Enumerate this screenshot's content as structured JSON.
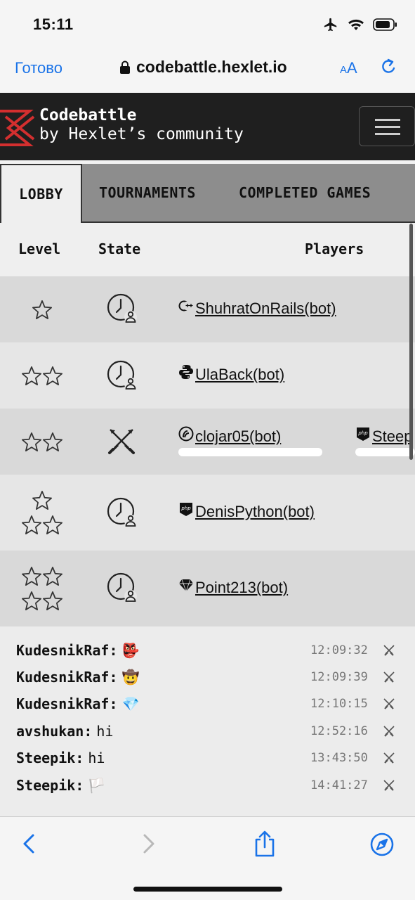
{
  "status_bar": {
    "time": "15:11"
  },
  "browser": {
    "done_label": "Готово",
    "url": "codebattle.hexlet.io",
    "text_size_small": "A",
    "text_size_large": "A"
  },
  "site": {
    "title": "Codebattle",
    "subtitle": "by Hexlet’s community"
  },
  "tabs": [
    {
      "label": "LOBBY",
      "active": true
    },
    {
      "label": "TOURNAMENTS",
      "active": false
    },
    {
      "label": "COMPLETED GAMES",
      "active": false
    }
  ],
  "table": {
    "headers": {
      "level": "Level",
      "state": "State",
      "players": "Players"
    },
    "rows": [
      {
        "level_stars": 1,
        "state_icon": "waiting-clock-icon",
        "players": [
          {
            "lang_icon": "cpp-icon",
            "name": "ShuhratOnRails(bot)"
          }
        ]
      },
      {
        "level_stars": 2,
        "state_icon": "waiting-clock-icon",
        "players": [
          {
            "lang_icon": "python-icon",
            "name": "UlaBack(bot)"
          }
        ]
      },
      {
        "level_stars": 2,
        "state_icon": "crossed-swords-icon",
        "players": [
          {
            "lang_icon": "clojure-icon",
            "name": "clojar05(bot)"
          },
          {
            "lang_icon": "php-icon",
            "name": "Steep"
          }
        ]
      },
      {
        "level_stars": 3,
        "state_icon": "waiting-clock-icon",
        "players": [
          {
            "lang_icon": "php-icon",
            "name": "DenisPython(bot)"
          }
        ]
      },
      {
        "level_stars": 4,
        "state_icon": "waiting-clock-icon",
        "players": [
          {
            "lang_icon": "ruby-icon",
            "name": "Point213(bot)"
          }
        ]
      }
    ]
  },
  "chat": [
    {
      "author": "KudesnikRaf:",
      "text": "👺",
      "time": "12:09:32"
    },
    {
      "author": "KudesnikRaf:",
      "text": "🤠",
      "time": "12:09:39"
    },
    {
      "author": "KudesnikRaf:",
      "text": "💎",
      "time": "12:10:15"
    },
    {
      "author": "avshukan:",
      "text": "hi",
      "time": "12:52:16"
    },
    {
      "author": "Steepik:",
      "text": "hi",
      "time": "13:43:50"
    },
    {
      "author": "Steepik:",
      "text": "🏳️",
      "time": "14:41:27"
    }
  ],
  "colors": {
    "accent": "#1a73e8",
    "header_bg": "#1f1f1f",
    "logo_red": "#d32f2f"
  }
}
